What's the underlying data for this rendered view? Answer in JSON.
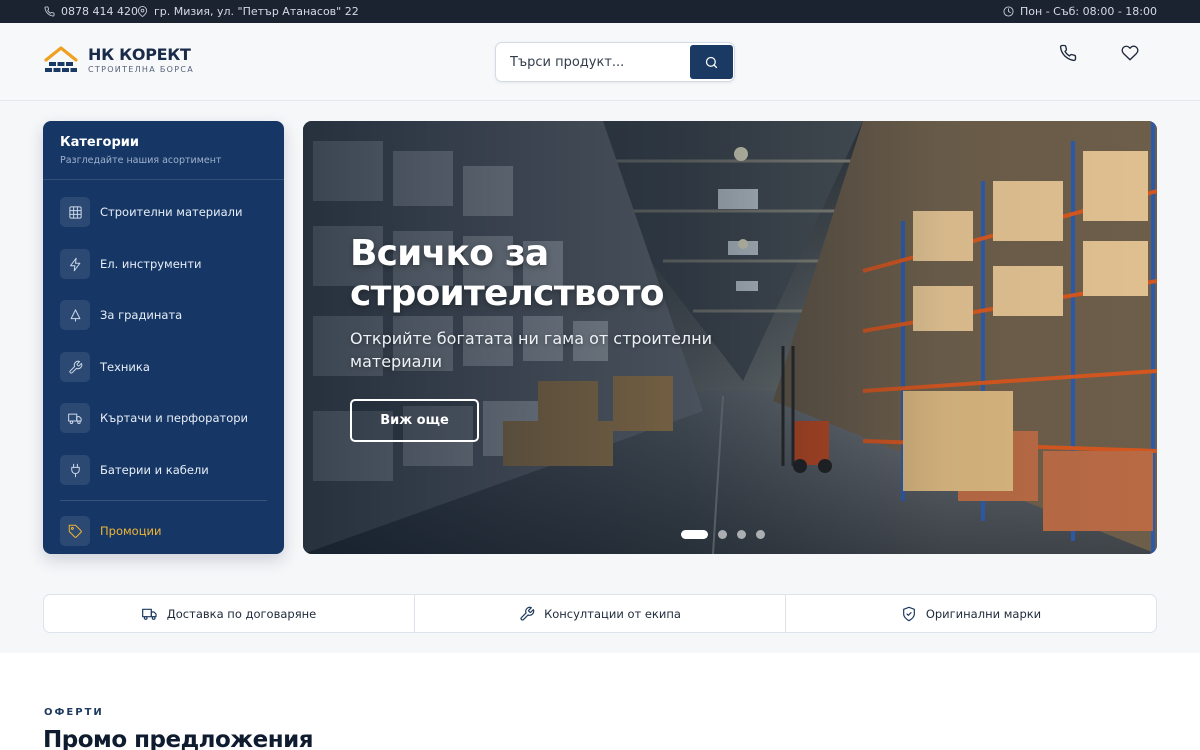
{
  "topbar": {
    "phone": "0878 414 420",
    "address": "гр. Мизия, ул. \"Петър Атанасов\" 22",
    "hours": "Пон - Съб: 08:00 - 18:00"
  },
  "header": {
    "logo_name": "НК КОРЕКТ",
    "logo_tagline": "СТРОИТЕЛНА БОРСА",
    "search_placeholder": "Търси продукт..."
  },
  "categories": {
    "title": "Категории",
    "subtitle": "Разгледайте нашия асортимент",
    "items": [
      {
        "label": "Строителни материали",
        "icon": "grid-icon"
      },
      {
        "label": "Ел. инструменти",
        "icon": "bolt-icon"
      },
      {
        "label": "За градината",
        "icon": "tree-icon"
      },
      {
        "label": "Техника",
        "icon": "wrench-icon"
      },
      {
        "label": "Къртачи и перфоратори",
        "icon": "truck-icon"
      },
      {
        "label": "Батерии и кабели",
        "icon": "plug-icon"
      }
    ],
    "promo_label": "Промоции",
    "promo_color": "#f2b533"
  },
  "hero": {
    "title": "Всичко за строителството",
    "subtitle": "Открийте богатата ни гама от строителни материали",
    "cta_label": "Виж още",
    "slide_count": 4,
    "active_slide": 1
  },
  "features": [
    {
      "label": "Доставка по договаряне",
      "icon": "truck-icon"
    },
    {
      "label": "Консултации от екипа",
      "icon": "wrench-icon"
    },
    {
      "label": "Оригинални марки",
      "icon": "shield-check-icon"
    }
  ],
  "offers": {
    "eyebrow": "ОФЕРТИ",
    "title": "Промо предложения"
  },
  "colors": {
    "brand_navy": "#163765",
    "topbar_bg": "#1b2230",
    "accent": "#f2b533",
    "logo_orange": "#f0a020"
  }
}
